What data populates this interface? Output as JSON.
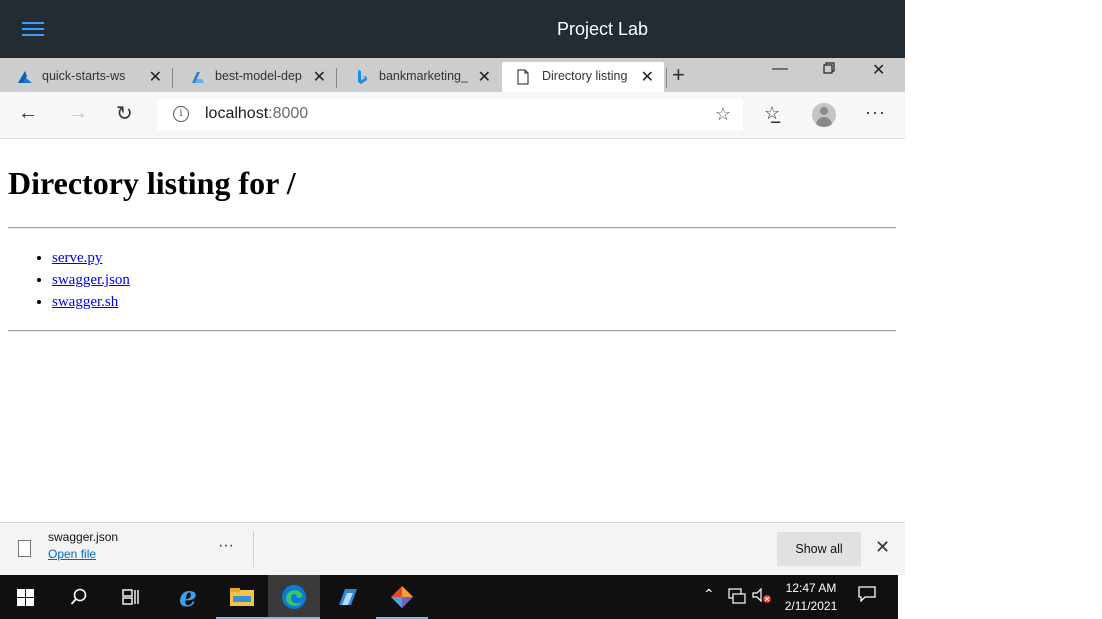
{
  "lab": {
    "title": "Project Lab"
  },
  "browser": {
    "tabs": [
      {
        "label": "quick-starts-ws",
        "icon": "azure-icon",
        "active": false
      },
      {
        "label": "best-model-dep",
        "icon": "azure-ml-icon",
        "active": false
      },
      {
        "label": "bankmarketing_",
        "icon": "bing-icon",
        "active": false
      },
      {
        "label": "Directory listing",
        "icon": "page-icon",
        "active": true
      }
    ],
    "address": {
      "host": "localhost",
      "port": ":8000"
    },
    "colors": {
      "titlebar": "#232b33",
      "accent": "#3aa0ff",
      "link": "#0000ee"
    }
  },
  "page": {
    "heading": "Directory listing for /",
    "files": [
      "serve.py",
      "swagger.json",
      "swagger.sh"
    ]
  },
  "download": {
    "filename": "swagger.json",
    "open_label": "Open file",
    "more_label": "···",
    "show_all_label": "Show all"
  },
  "taskbar": {
    "time": "12:47 AM",
    "date": "2/11/2021"
  }
}
